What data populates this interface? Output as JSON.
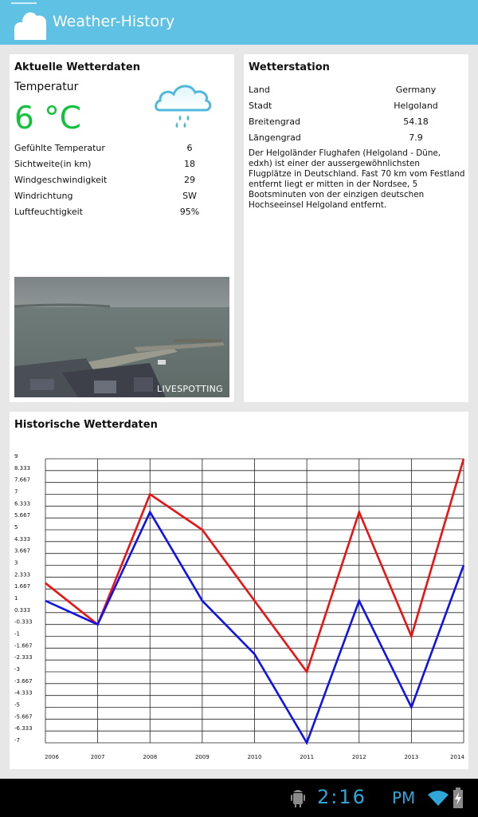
{
  "app": {
    "title": "Weather-History",
    "icon": "cloud-logo-icon",
    "colors": {
      "actionbar": "#5fc2e4",
      "temperature": "#12c23c"
    }
  },
  "current": {
    "heading": "Aktuelle Wetterdaten",
    "temp_label": "Temperatur",
    "temp_value": "6 °C",
    "condition_icon": "cloud-rain-icon",
    "rows": [
      {
        "label": "Gefühlte Temperatur",
        "value": "6"
      },
      {
        "label": "Sichtweite(in km)",
        "value": "18"
      },
      {
        "label": "Windgeschwindigkeit",
        "value": "29"
      },
      {
        "label": "Windrichtung",
        "value": "SW"
      },
      {
        "label": "Luftfeuchtigkeit",
        "value": "95%"
      }
    ],
    "webcam_watermark": "LIVESPOTTING"
  },
  "station": {
    "heading": "Wetterstation",
    "rows": [
      {
        "label": "Land",
        "value": "Germany"
      },
      {
        "label": "Stadt",
        "value": "Helgoland"
      },
      {
        "label": "Breitengrad",
        "value": "54.18"
      },
      {
        "label": "Längengrad",
        "value": "7.9"
      }
    ],
    "description": "Der Helgoländer Flughafen (Helgoland - Düne, edxh) ist einer der aussergewöhnlichsten Flugplätze in Deutschland. Fast 70 km vom Festland entfernt liegt er mitten in der Nordsee, 5 Bootsminuten von der einzigen deutschen Hochseeinsel Helgoland entfernt."
  },
  "history": {
    "heading": "Historische Wetterdaten"
  },
  "chart_data": {
    "type": "line",
    "title": "",
    "xlabel": "",
    "ylabel": "",
    "x": [
      "2006",
      "2007",
      "2008",
      "2009",
      "2010",
      "2011",
      "2012",
      "2013",
      "2014"
    ],
    "y_ticks": [
      "9",
      "8.333",
      "7.667",
      "7",
      "6.333",
      "5.667",
      "5",
      "4.333",
      "3.667",
      "3",
      "2.333",
      "1.667",
      "1",
      "0.333",
      "-0.333",
      "-1",
      "-1.667",
      "-2.333",
      "-3",
      "-3.667",
      "-4.333",
      "-5",
      "-5.667",
      "-6.333",
      "-7"
    ],
    "ylim": [
      -7,
      9
    ],
    "grid": true,
    "series": [
      {
        "color": "#ee1111",
        "values": [
          2,
          -0.333,
          7,
          5,
          1,
          -3,
          6,
          -1,
          9
        ]
      },
      {
        "color": "#1111ee",
        "values": [
          1,
          -0.333,
          6,
          1,
          -2,
          -7,
          1,
          -5,
          3
        ]
      }
    ]
  },
  "statusbar": {
    "time": "2:16",
    "ampm": "PM",
    "icons": [
      "android-debug-icon",
      "wifi-icon",
      "battery-charging-icon"
    ]
  }
}
